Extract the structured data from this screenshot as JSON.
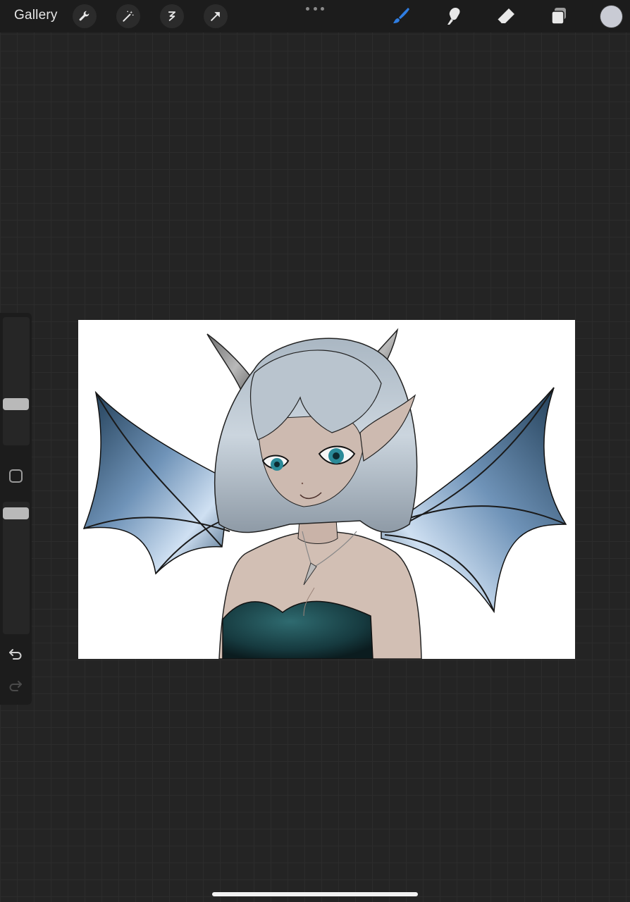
{
  "topbar": {
    "gallery_label": "Gallery",
    "left_tools": [
      "wrench-icon",
      "magic-wand-icon",
      "selection-icon",
      "transform-arrow-icon"
    ],
    "right_tools": [
      "brush-icon",
      "smudge-icon",
      "eraser-icon",
      "layers-icon"
    ],
    "active_tool": "brush-icon",
    "active_color": "#2f7de1",
    "current_color": "#c9cbd4"
  },
  "sidebar": {
    "brush_size_level": 0.55,
    "opacity_level": 0.95,
    "icons": [
      "modify-square-icon",
      "undo-icon",
      "redo-icon"
    ]
  },
  "canvas": {
    "background": "#ffffff",
    "artwork": "dragon-girl-illustration"
  }
}
